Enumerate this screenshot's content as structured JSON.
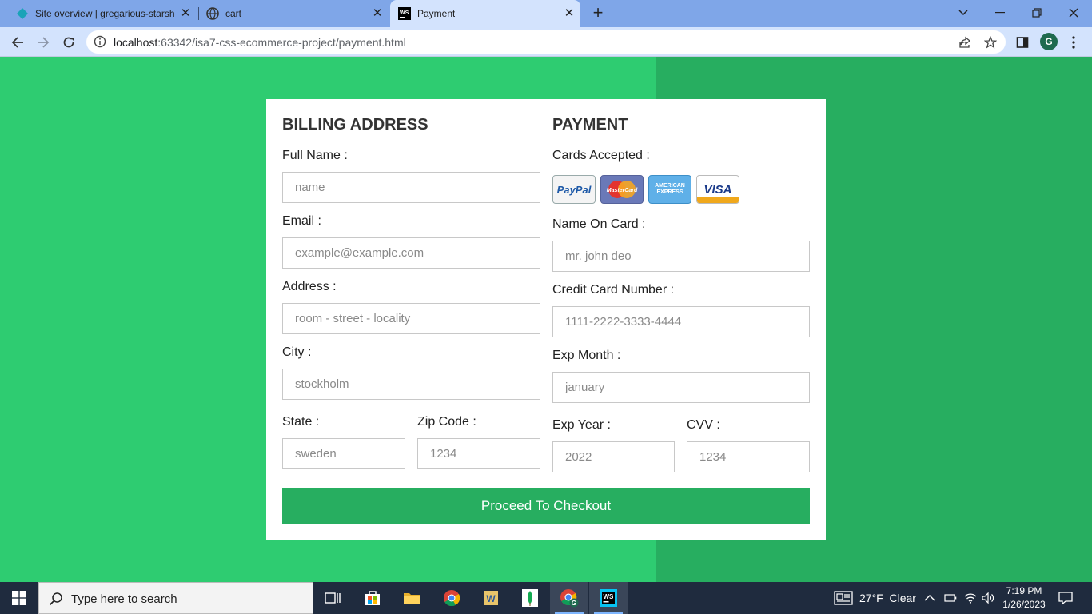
{
  "browser": {
    "tabs": [
      {
        "title": "Site overview | gregarious-starsh",
        "icon": "netlify-icon"
      },
      {
        "title": "cart",
        "icon": "globe-icon"
      },
      {
        "title": "Payment",
        "icon": "webstorm-icon"
      }
    ],
    "url_host": "localhost",
    "url_rest": ":63342/isa7-css-ecommerce-project/payment.html",
    "profile_initial": "G"
  },
  "billing": {
    "heading": "billing address",
    "full_name_label": "Full Name :",
    "full_name_placeholder": "name",
    "email_label": "Email :",
    "email_placeholder": "example@example.com",
    "address_label": "Address :",
    "address_placeholder": "room - street - locality",
    "city_label": "City :",
    "city_placeholder": "stockholm",
    "state_label": "State :",
    "state_placeholder": "sweden",
    "zip_label": "Zip Code :",
    "zip_placeholder": "1234"
  },
  "payment": {
    "heading": "payment",
    "cards_label": "Cards Accepted :",
    "cards": [
      "PayPal",
      "MasterCard",
      "AMERICAN EXPRESS",
      "VISA"
    ],
    "name_label": "Name On Card :",
    "name_placeholder": "mr. john deo",
    "number_label": "Credit Card Number :",
    "number_placeholder": "1111-2222-3333-4444",
    "month_label": "Exp Month :",
    "month_placeholder": "january",
    "year_label": "Exp Year :",
    "year_placeholder": "2022",
    "cvv_label": "CVV :",
    "cvv_placeholder": "1234"
  },
  "checkout_label": "Proceed To Checkout",
  "taskbar": {
    "search_placeholder": "Type here to search",
    "weather": "27°F  Clear",
    "time": "7:19 PM",
    "date": "1/26/2023"
  },
  "colors": {
    "page_bg": "#2ecc71",
    "page_bg_dark": "#27ae60",
    "button": "#27ae60",
    "tab_strip": "#7fa6e8",
    "taskbar": "#1f2b3e"
  }
}
